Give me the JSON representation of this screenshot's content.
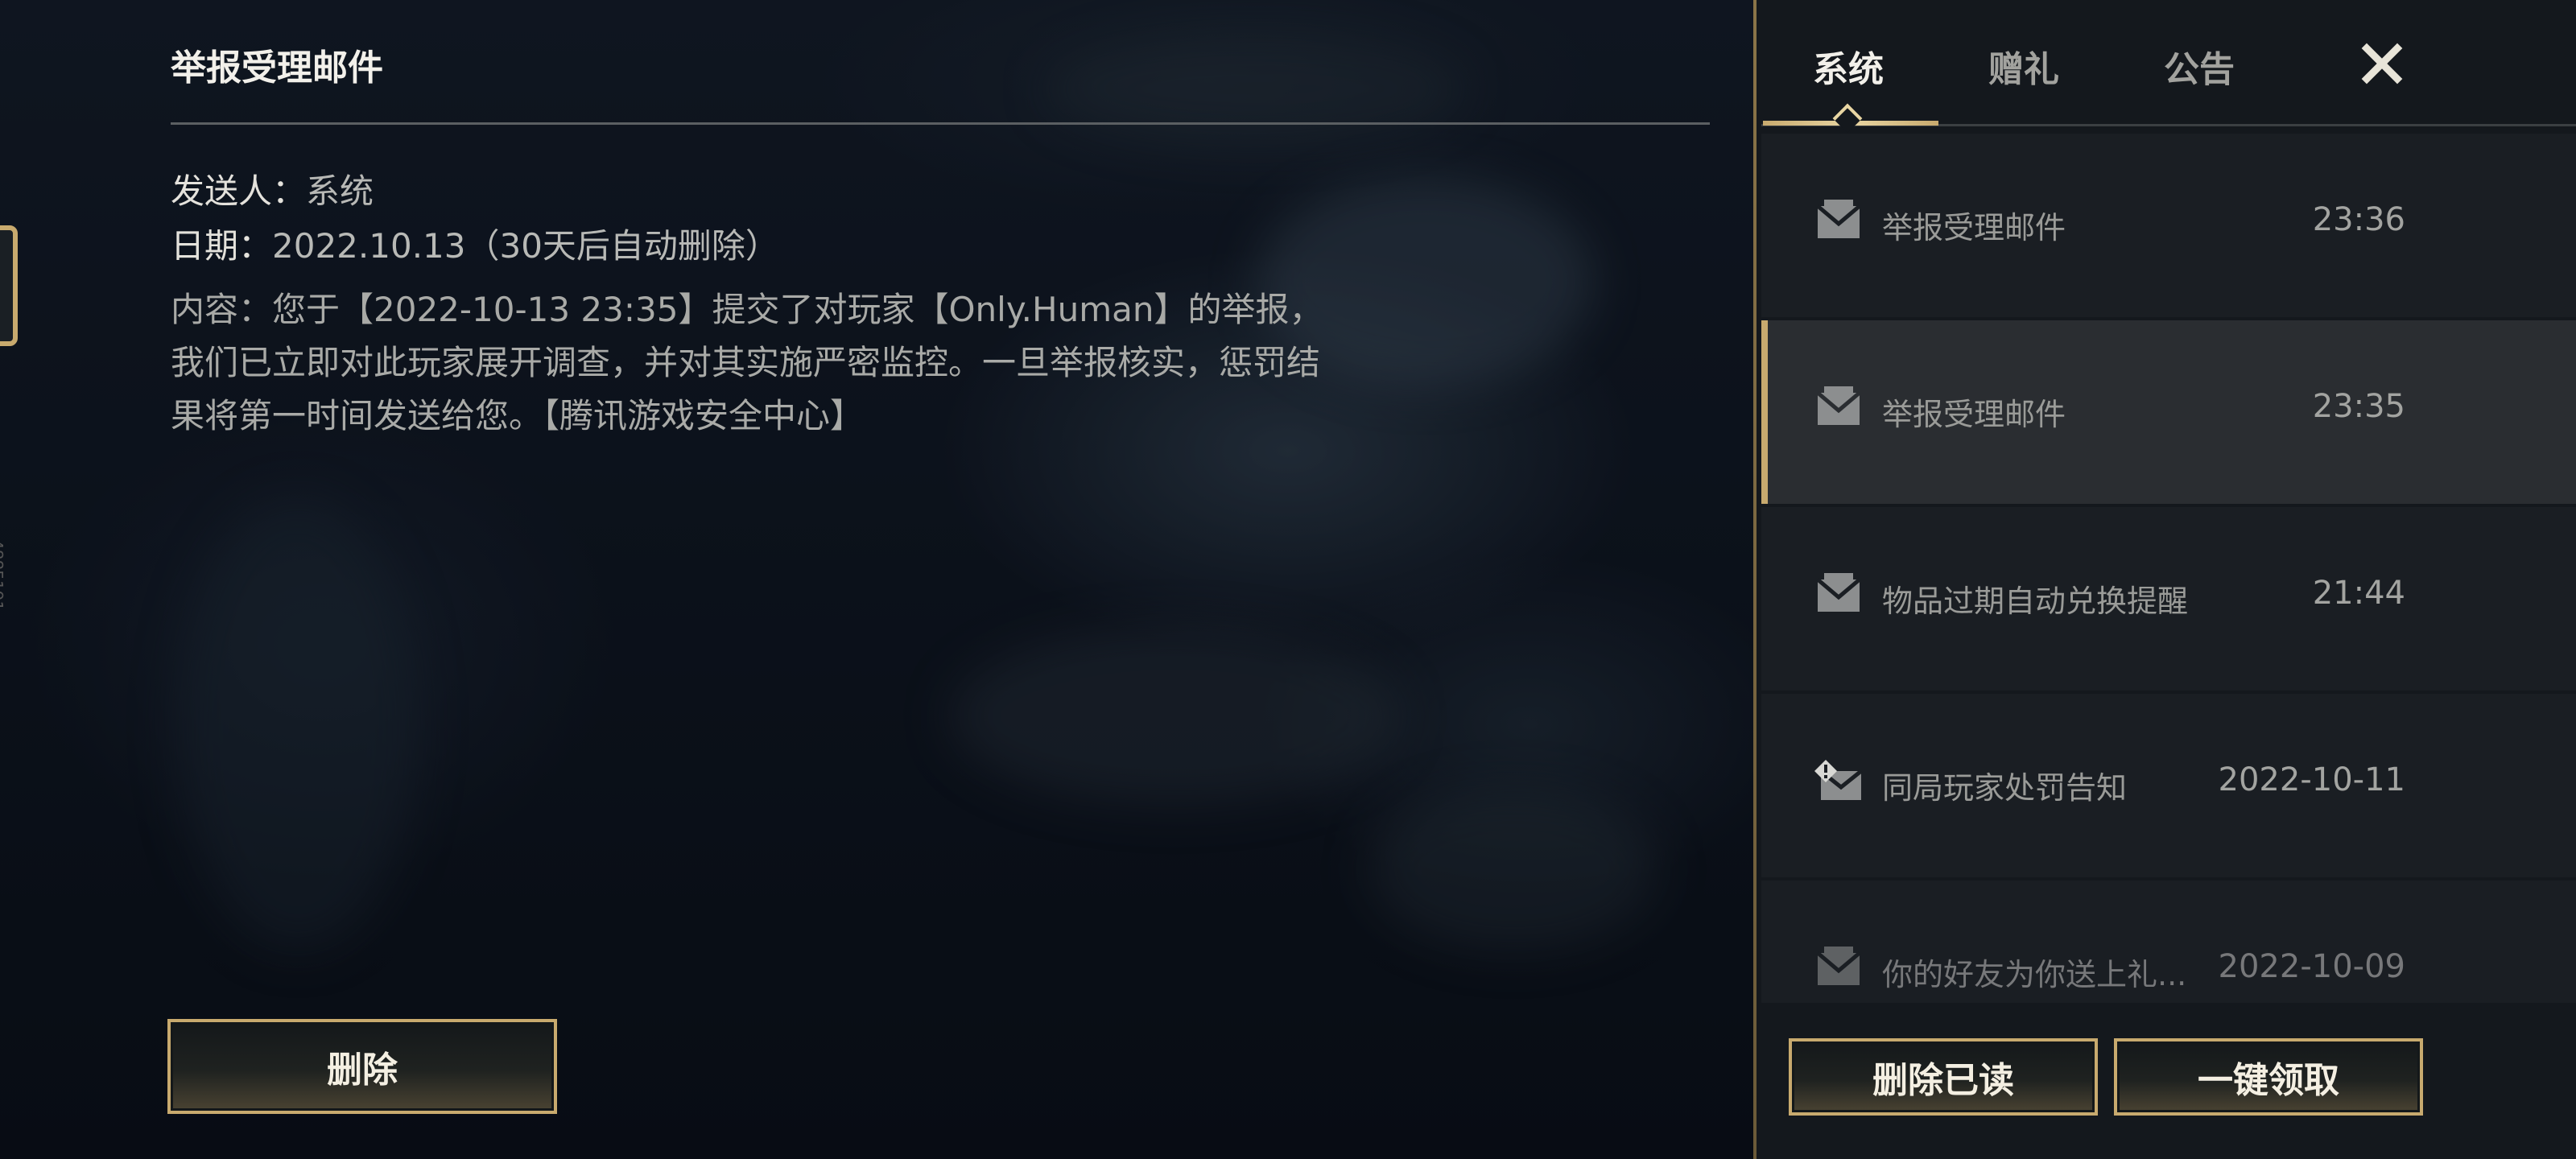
{
  "mail_detail": {
    "title": "举报受理邮件",
    "sender_label": "发送人：",
    "sender_value": "系统",
    "date_label": "日期：",
    "date_value": "2022.10.13（30天后自动删除）",
    "content": "内容：您于【2022-10-13 23:35】提交了对玩家【Only.Human】的举报，我们已立即对此玩家展开调查，并对其实施严密监控。一旦举报核实，惩罚结果将第一时间发送给您。【腾讯游戏安全中心】",
    "delete_label": "删除"
  },
  "side_code": "4885191",
  "tabs": [
    {
      "label": "系统",
      "active": true
    },
    {
      "label": "赠礼",
      "active": false
    },
    {
      "label": "公告",
      "active": false
    }
  ],
  "mail_list": [
    {
      "title": "举报受理邮件",
      "time": "23:36",
      "icon": "mail-icon",
      "selected": false
    },
    {
      "title": "举报受理邮件",
      "time": "23:35",
      "icon": "mail-icon",
      "selected": true
    },
    {
      "title": "物品过期自动兑换提醒",
      "time": "21:44",
      "icon": "mail-icon",
      "selected": false
    },
    {
      "title": "同局玩家处罚告知",
      "time": "2022-10-11",
      "icon": "mail-alert-icon",
      "selected": false
    },
    {
      "title": "你的好友为你送上礼...",
      "time": "2022-10-09",
      "icon": "mail-icon",
      "selected": false
    }
  ],
  "footer": {
    "delete_read_label": "删除已读",
    "claim_all_label": "一键领取"
  },
  "colors": {
    "accent_gold": "#c8aa6e",
    "panel_bg": "#14181d",
    "selected_row_bg": "#2a2d31"
  }
}
